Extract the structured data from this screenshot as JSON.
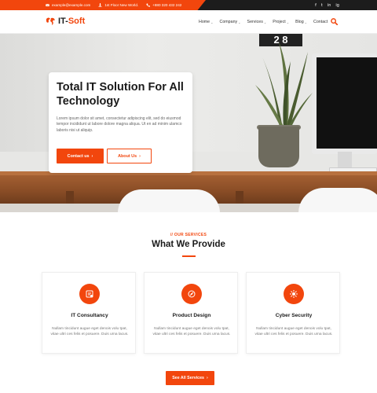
{
  "topbar": {
    "email": "example@example.com",
    "address": "1st Floor New World.",
    "phone": "+880 320 432 242",
    "social": [
      "f",
      "t",
      "in",
      "ig"
    ],
    "accent_color": "#f2460d",
    "dark_color": "#1c1c1c"
  },
  "nav": {
    "logo_prefix": "IT-",
    "logo_accent": "Soft",
    "items": [
      {
        "label": "Home",
        "dropdown": true
      },
      {
        "label": "Company",
        "dropdown": true
      },
      {
        "label": "Services",
        "dropdown": true
      },
      {
        "label": "Project",
        "dropdown": true
      },
      {
        "label": "Blog",
        "dropdown": true
      },
      {
        "label": "Contact",
        "dropdown": false
      }
    ]
  },
  "hero": {
    "title": "Total IT Solution For All Technology",
    "description": "Lorem ipsum dolor sit amet, consectetur adipiscing elit, sed do eiusmod tempor incididunt ut labore dolore magna aliqua. Ut en ad minim ulamco laboris nisi ut aliquip.",
    "calendar_text": "2 8",
    "primary_button": "Contact us",
    "secondary_button": "About Us"
  },
  "services": {
    "tag": "// OUR SERVICES",
    "title": "What We Provide",
    "cards": [
      {
        "title": "IT Consultancy",
        "description": "Nullam tincidunt augue eget denois volu tpat, vitae ultri ces felis et posuere. Duis urna lacus.",
        "icon": "consultancy-icon"
      },
      {
        "title": "Product Design",
        "description": "Nullam tincidunt augue eget denois volu tpat, vitae ultri ces felis et posuere. Duis urna lacus.",
        "icon": "design-icon"
      },
      {
        "title": "Cyber Security",
        "description": "Nullam tincidunt augue eget denois volu tpat, vitae ultri ces felis et posuere. Duis urna lacus.",
        "icon": "security-icon"
      }
    ],
    "all_button": "See All Services"
  }
}
